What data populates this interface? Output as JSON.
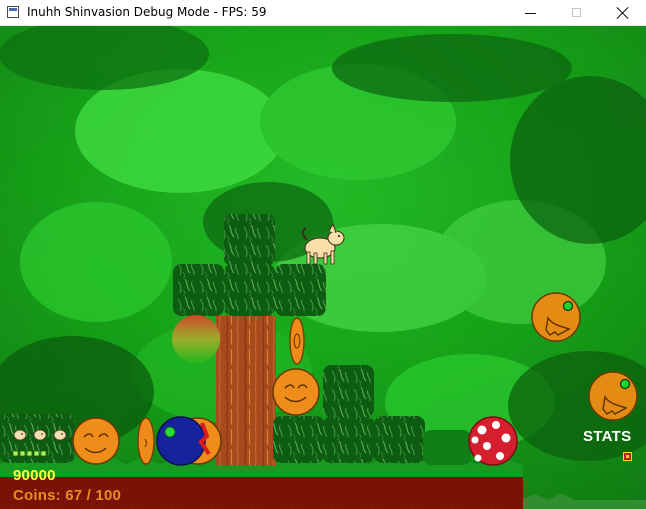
{
  "window": {
    "title": "Inuhh Shinvasion Debug Mode - FPS: 59",
    "minimize_icon": "minimize-icon",
    "maximize_icon": "maximize-icon",
    "close_icon": "close-icon"
  },
  "hud": {
    "score": "90000",
    "coins": "Coins: 67 / 100",
    "stats_label": "STATS",
    "lives_icons": [
      "small-dog-head-icon",
      "small-dog-head-icon",
      "small-dog-head-icon"
    ],
    "health_pips": 5,
    "stats_toggle_icon": "stats-toggle-icon"
  },
  "colors": {
    "forest_dark": "#0d5b0d",
    "forest_mid": "#18a018",
    "forest_light": "#27c62b",
    "ground_soil": "#7a1306",
    "score_yellow": "#ffff3b",
    "coin_orange": "#e68c23",
    "stats_white": "#ffffff"
  },
  "scene": {
    "player": "dog-player-sprite",
    "enemies": [
      "orange-bird-enemy",
      "orange-bird-enemy",
      "red-spotted-ball-enemy",
      "blue-ball-enemy"
    ],
    "items": [
      "orange-coin",
      "orange-coin",
      "orange-coin",
      "green-orange-orb"
    ]
  }
}
